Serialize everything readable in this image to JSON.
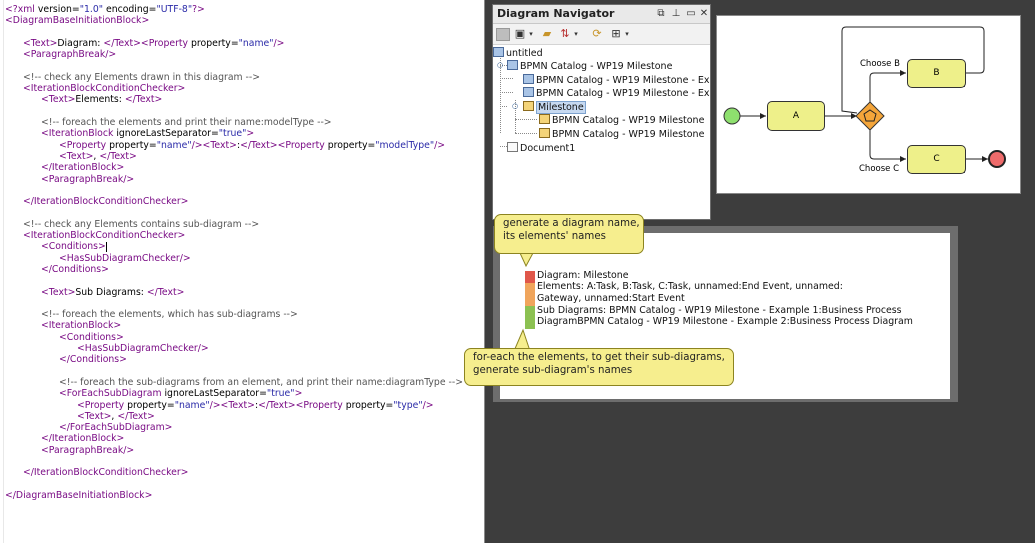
{
  "editor": {
    "lines": [
      {
        "parts": [
          [
            "pi",
            "<?"
          ],
          [
            "tag",
            "xml"
          ],
          [
            "attr",
            " version="
          ],
          [
            "val",
            "\"1.0\""
          ],
          [
            "attr",
            " encoding="
          ],
          [
            "val",
            "\"UTF-8\""
          ],
          [
            "pi",
            "?>"
          ]
        ]
      },
      {
        "parts": [
          [
            "tag",
            "<DiagramBaseInitiationBlock>"
          ]
        ]
      },
      {
        "parts": []
      },
      {
        "indent": 1,
        "parts": [
          [
            "tag",
            "<Text>"
          ],
          [
            "txt",
            "Diagram: "
          ],
          [
            "tag",
            "</Text>"
          ],
          [
            "tag",
            "<Property "
          ],
          [
            "attr",
            "property="
          ],
          [
            "val",
            "\"name\""
          ],
          [
            "tag",
            "/>"
          ]
        ]
      },
      {
        "indent": 1,
        "parts": [
          [
            "tag",
            "<ParagraphBreak/>"
          ]
        ]
      },
      {
        "parts": []
      },
      {
        "indent": 1,
        "parts": [
          [
            "cmt",
            "<!-- check any Elements drawn in this diagram -->"
          ]
        ]
      },
      {
        "indent": 1,
        "parts": [
          [
            "tag",
            "<IterationBlockConditionChecker>"
          ]
        ]
      },
      {
        "indent": 2,
        "parts": [
          [
            "tag",
            "<Text>"
          ],
          [
            "txt",
            "Elements: "
          ],
          [
            "tag",
            "</Text>"
          ]
        ]
      },
      {
        "parts": []
      },
      {
        "indent": 2,
        "parts": [
          [
            "cmt",
            "<!-- foreach the elements and print their name:modelType -->"
          ]
        ]
      },
      {
        "indent": 2,
        "parts": [
          [
            "tag",
            "<IterationBlock "
          ],
          [
            "attr",
            "ignoreLastSeparator="
          ],
          [
            "val",
            "\"true\""
          ],
          [
            "tag",
            ">"
          ]
        ]
      },
      {
        "indent": 3,
        "parts": [
          [
            "tag",
            "<Property "
          ],
          [
            "attr",
            "property="
          ],
          [
            "val",
            "\"name\""
          ],
          [
            "tag",
            "/>"
          ],
          [
            "tag",
            "<Text>"
          ],
          [
            "txt",
            ":"
          ],
          [
            "tag",
            "</Text>"
          ],
          [
            "tag",
            "<Property "
          ],
          [
            "attr",
            "property="
          ],
          [
            "val",
            "\"modelType\""
          ],
          [
            "tag",
            "/>"
          ]
        ]
      },
      {
        "indent": 3,
        "parts": [
          [
            "tag",
            "<Text>"
          ],
          [
            "txt",
            ", "
          ],
          [
            "tag",
            "</Text>"
          ]
        ]
      },
      {
        "indent": 2,
        "parts": [
          [
            "tag",
            "</IterationBlock>"
          ]
        ]
      },
      {
        "indent": 2,
        "parts": [
          [
            "tag",
            "<ParagraphBreak/>"
          ]
        ]
      },
      {
        "parts": []
      },
      {
        "indent": 1,
        "parts": [
          [
            "tag",
            "</IterationBlockConditionChecker>"
          ]
        ]
      },
      {
        "parts": []
      },
      {
        "indent": 1,
        "parts": [
          [
            "cmt",
            "<!-- check any Elements contains sub-diagram -->"
          ]
        ]
      },
      {
        "indent": 1,
        "parts": [
          [
            "tag",
            "<IterationBlockConditionChecker>"
          ]
        ]
      },
      {
        "indent": 2,
        "parts": [
          [
            "tag",
            "<Conditions>"
          ]
        ],
        "caret": true
      },
      {
        "indent": 3,
        "parts": [
          [
            "tag",
            "<HasSubDiagramChecker/>"
          ]
        ]
      },
      {
        "indent": 2,
        "parts": [
          [
            "tag",
            "</Conditions>"
          ]
        ]
      },
      {
        "parts": []
      },
      {
        "indent": 2,
        "parts": [
          [
            "tag",
            "<Text>"
          ],
          [
            "txt",
            "Sub Diagrams: "
          ],
          [
            "tag",
            "</Text>"
          ]
        ]
      },
      {
        "parts": []
      },
      {
        "indent": 2,
        "parts": [
          [
            "cmt",
            "<!-- foreach the elements, which has sub-diagrams -->"
          ]
        ]
      },
      {
        "indent": 2,
        "parts": [
          [
            "tag",
            "<IterationBlock>"
          ]
        ]
      },
      {
        "indent": 3,
        "parts": [
          [
            "tag",
            "<Conditions>"
          ]
        ]
      },
      {
        "indent": 4,
        "parts": [
          [
            "tag",
            "<HasSubDiagramChecker/>"
          ]
        ]
      },
      {
        "indent": 3,
        "parts": [
          [
            "tag",
            "</Conditions>"
          ]
        ]
      },
      {
        "parts": []
      },
      {
        "indent": 3,
        "parts": [
          [
            "cmt",
            "<!-- foreach the sub-diagrams from an element, and print their name:diagramType -->"
          ]
        ]
      },
      {
        "indent": 3,
        "parts": [
          [
            "tag",
            "<ForEachSubDiagram "
          ],
          [
            "attr",
            "ignoreLastSeparator="
          ],
          [
            "val",
            "\"true\""
          ],
          [
            "tag",
            ">"
          ]
        ]
      },
      {
        "indent": 4,
        "parts": [
          [
            "tag",
            "<Property "
          ],
          [
            "attr",
            "property="
          ],
          [
            "val",
            "\"name\""
          ],
          [
            "tag",
            "/>"
          ],
          [
            "tag",
            "<Text>"
          ],
          [
            "txt",
            ":"
          ],
          [
            "tag",
            "</Text>"
          ],
          [
            "tag",
            "<Property "
          ],
          [
            "attr",
            "property="
          ],
          [
            "val",
            "\"type\""
          ],
          [
            "tag",
            "/>"
          ]
        ]
      },
      {
        "indent": 4,
        "parts": [
          [
            "tag",
            "<Text>"
          ],
          [
            "txt",
            ", "
          ],
          [
            "tag",
            "</Text>"
          ]
        ]
      },
      {
        "indent": 3,
        "parts": [
          [
            "tag",
            "</ForEachSubDiagram>"
          ]
        ]
      },
      {
        "indent": 2,
        "parts": [
          [
            "tag",
            "</IterationBlock>"
          ]
        ]
      },
      {
        "indent": 2,
        "parts": [
          [
            "tag",
            "<ParagraphBreak/>"
          ]
        ]
      },
      {
        "parts": []
      },
      {
        "indent": 1,
        "parts": [
          [
            "tag",
            "</IterationBlockConditionChecker>"
          ]
        ]
      },
      {
        "parts": []
      },
      {
        "parts": [
          [
            "tag",
            "</DiagramBaseInitiationBlock>"
          ]
        ]
      }
    ]
  },
  "navigator": {
    "title": "Diagram Navigator",
    "header_icons": [
      "restore-icon",
      "pin-icon",
      "minimize-icon",
      "close-icon"
    ],
    "toolbar_icons": [
      "stop-icon",
      "view-icon",
      "open-folder-icon",
      "sort-icon",
      "refresh-icon",
      "tree-layout-icon"
    ],
    "tree": [
      {
        "label": "untitled",
        "icon": "project-icon"
      },
      {
        "label": "BPMN Catalog - WP19 Milestone",
        "icon": "model-icon"
      },
      {
        "label": "BPMN Catalog - WP19 Milestone - Ex",
        "icon": "model-icon"
      },
      {
        "label": "BPMN Catalog - WP19 Milestone - Ex",
        "icon": "model-icon"
      },
      {
        "label": "Milestone",
        "icon": "bpmn-diagram-icon",
        "selected": true
      },
      {
        "label": "BPMN Catalog - WP19 Milestone",
        "icon": "bpmn-diagram-icon"
      },
      {
        "label": "BPMN Catalog - WP19 Milestone",
        "icon": "bpmn-diagram-icon"
      },
      {
        "label": "Document1",
        "icon": "document-icon"
      }
    ]
  },
  "diagram": {
    "task_a": "A",
    "task_b": "B",
    "task_c": "C",
    "flow_b_label": "Choose B",
    "flow_c_label": "Choose C"
  },
  "output": {
    "lines": [
      "Diagram: Milestone",
      "Elements: A:Task, B:Task, C:Task, unnamed:End Event, unnamed:",
      "Gateway, unnamed:Start Event",
      "Sub Diagrams: BPMN Catalog - WP19 Milestone - Example 1:Business Process",
      "DiagramBPMN Catalog - WP19 Milestone - Example 2:Business Process Diagram"
    ],
    "bar_colors": [
      "#e0574a",
      "#f0a55c",
      "#f0a55c",
      "#8cc152",
      "#8cc152"
    ]
  },
  "callouts": {
    "top": [
      "generate a diagram name,",
      "its elements' names"
    ],
    "bottom": [
      "for-each the elements, to get their sub-diagrams,",
      "generate sub-diagram's names"
    ]
  },
  "colors": {
    "background": "#3d3d3d",
    "task_fill": "#eef08a",
    "callout_fill": "#f6ee8e",
    "start_event": "#8ee06e",
    "end_event": "#ee6b6b",
    "gateway": "#f4a53a",
    "selection": "#c6d9f1"
  }
}
